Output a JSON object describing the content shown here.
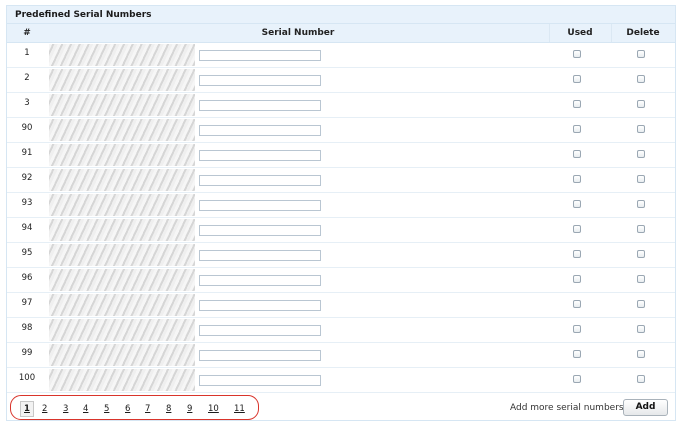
{
  "panel": {
    "title": "Predefined Serial Numbers"
  },
  "table": {
    "headers": {
      "index": "#",
      "serial": "Serial Number",
      "used": "Used",
      "delete": "Delete"
    },
    "rows": [
      {
        "num": "1",
        "used": false,
        "delete": false
      },
      {
        "num": "2",
        "used": false,
        "delete": false
      },
      {
        "num": "3",
        "used": false,
        "delete": false
      },
      {
        "num": "90",
        "used": false,
        "delete": false
      },
      {
        "num": "91",
        "used": false,
        "delete": false
      },
      {
        "num": "92",
        "used": false,
        "delete": false
      },
      {
        "num": "93",
        "used": false,
        "delete": false
      },
      {
        "num": "94",
        "used": false,
        "delete": false
      },
      {
        "num": "95",
        "used": false,
        "delete": false
      },
      {
        "num": "96",
        "used": false,
        "delete": false
      },
      {
        "num": "97",
        "used": false,
        "delete": false
      },
      {
        "num": "98",
        "used": false,
        "delete": false
      },
      {
        "num": "99",
        "used": false,
        "delete": false
      },
      {
        "num": "100",
        "used": false,
        "delete": false
      }
    ]
  },
  "pagination": {
    "pages": [
      "1",
      "2",
      "3",
      "4",
      "5",
      "6",
      "7",
      "8",
      "9",
      "10",
      "11"
    ],
    "current": "1",
    "highlight_color": "#d9342b"
  },
  "add_more": {
    "prompt": "Add more serial numbers?",
    "button_label": "Add"
  }
}
